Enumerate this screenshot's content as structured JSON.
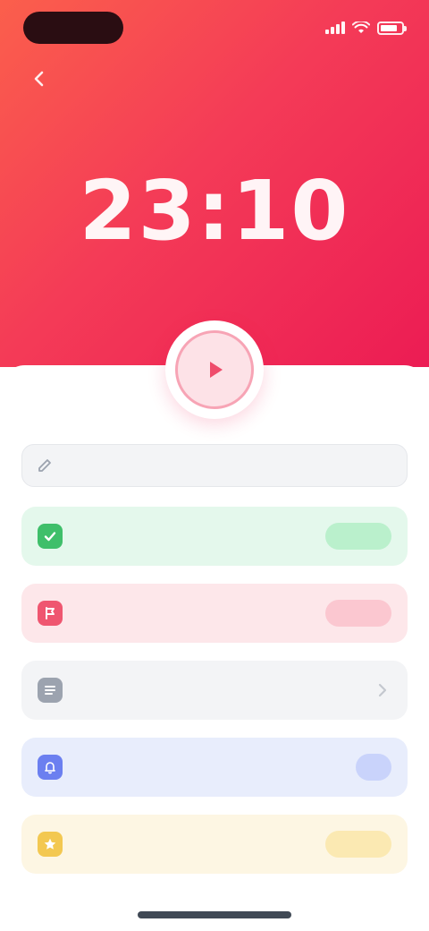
{
  "status_bar": {
    "time": "",
    "battery_level": 0.8
  },
  "nav": {
    "title": "",
    "back_icon": "chevron-left-icon"
  },
  "timer": {
    "display": "23:10"
  },
  "play_button": {
    "icon": "play-icon"
  },
  "task_input": {
    "value": "",
    "placeholder": "",
    "icon": "edit-icon"
  },
  "rows": [
    {
      "label": "",
      "badge": "",
      "icon": "check-icon",
      "bg": "#e4f8ec",
      "icon_bg": "#3fbf6a",
      "badge_bg": "#baf0cc",
      "badge_color": "#1e8a45"
    },
    {
      "label": "",
      "badge": "",
      "icon": "flag-icon",
      "bg": "#fde7ea",
      "icon_bg": "#ef5670",
      "badge_bg": "#fbc7d0",
      "badge_color": "#c8264a"
    },
    {
      "label": "",
      "badge": "",
      "icon": "list-icon",
      "bg": "#f3f4f6",
      "icon_bg": "#9ca3af",
      "badge_bg": "",
      "badge_color": ""
    },
    {
      "label": "",
      "badge": "",
      "icon": "bell-icon",
      "bg": "#e8edfc",
      "icon_bg": "#6b7ff0",
      "badge_bg": "#c9d3fb",
      "badge_color": "#3b50c9"
    },
    {
      "label": "",
      "badge": "",
      "icon": "star-icon",
      "bg": "#fdf6e3",
      "icon_bg": "#f3c851",
      "badge_bg": "#fbe9b2",
      "badge_color": "#a87c10"
    }
  ],
  "colors": {
    "gradient_start": "#fb5f4c",
    "gradient_mid": "#f43b57",
    "gradient_end": "#ec1c54",
    "accent": "#ec1c54"
  }
}
